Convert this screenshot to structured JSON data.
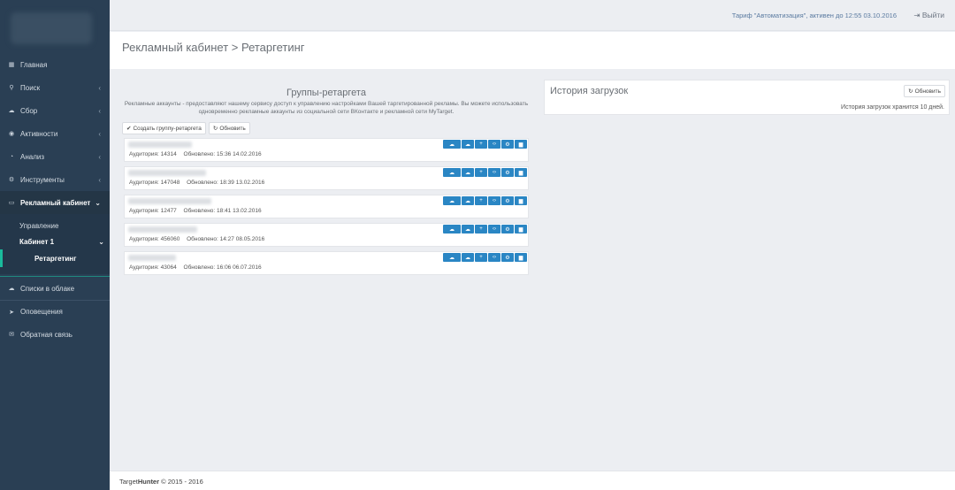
{
  "topbar": {
    "tariff": "Тариф \"Автоматизация\", активен до 12:55 03.10.2016",
    "logout_icon": "sign-out-icon",
    "logout_label": "Выйти"
  },
  "sidebar": {
    "items": [
      {
        "label": "Главная",
        "icon": "grid-icon"
      },
      {
        "label": "Поиск",
        "icon": "search-icon"
      },
      {
        "label": "Сбор",
        "icon": "cloud-download-icon"
      },
      {
        "label": "Активности",
        "icon": "eye-icon"
      },
      {
        "label": "Анализ",
        "icon": "pie-chart-icon"
      },
      {
        "label": "Инструменты",
        "icon": "gear-icon"
      },
      {
        "label": "Рекламный кабинет",
        "icon": "laptop-icon"
      }
    ],
    "sub": {
      "manage": "Управление",
      "cabinet": "Кабинет 1",
      "retargeting": "Ретаргетинг"
    },
    "bottom": [
      {
        "label": "Списки в облаке",
        "icon": "cloud-icon"
      },
      {
        "label": "Оповещения",
        "icon": "paper-plane-icon"
      },
      {
        "label": "Обратная связь",
        "icon": "envelope-icon"
      }
    ]
  },
  "page": {
    "title": "Рекламный кабинет > Ретаргетинг"
  },
  "groups_panel": {
    "title": "Группы-ретаргета",
    "desc": "Рекламные аккаунты - предоставляют нашему сервису доступ к управлению настройками Вашей таргетированной рекламы. Вы можете использовать одновременно рекламные аккаунты из социальной сети ВКонтакте и рекламной сети MyTarget.",
    "create_label": "Создать группу-ретаргета",
    "refresh_label": "Обновить",
    "groups": [
      {
        "audience": "Аудитория: 14314",
        "updated": "Обновлено: 15:36 14.02.2016"
      },
      {
        "audience": "Аудитория: 147048",
        "updated": "Обновлено: 18:39 13.02.2016"
      },
      {
        "audience": "Аудитория: 12477",
        "updated": "Обновлено: 18:41 13.02.2016"
      },
      {
        "audience": "Аудитория: 456060",
        "updated": "Обновлено: 14:27 08.05.2016"
      },
      {
        "audience": "Аудитория: 43064",
        "updated": "Обновлено: 16:06 06.07.2016"
      }
    ]
  },
  "history_panel": {
    "title": "История загрузок",
    "refresh_label": "Обновить",
    "note": "История загрузок хранится 10 дней."
  },
  "footer": {
    "brand_prefix": "Target",
    "brand_bold": "Hunter",
    "copyright": "© 2015 - 2016"
  }
}
